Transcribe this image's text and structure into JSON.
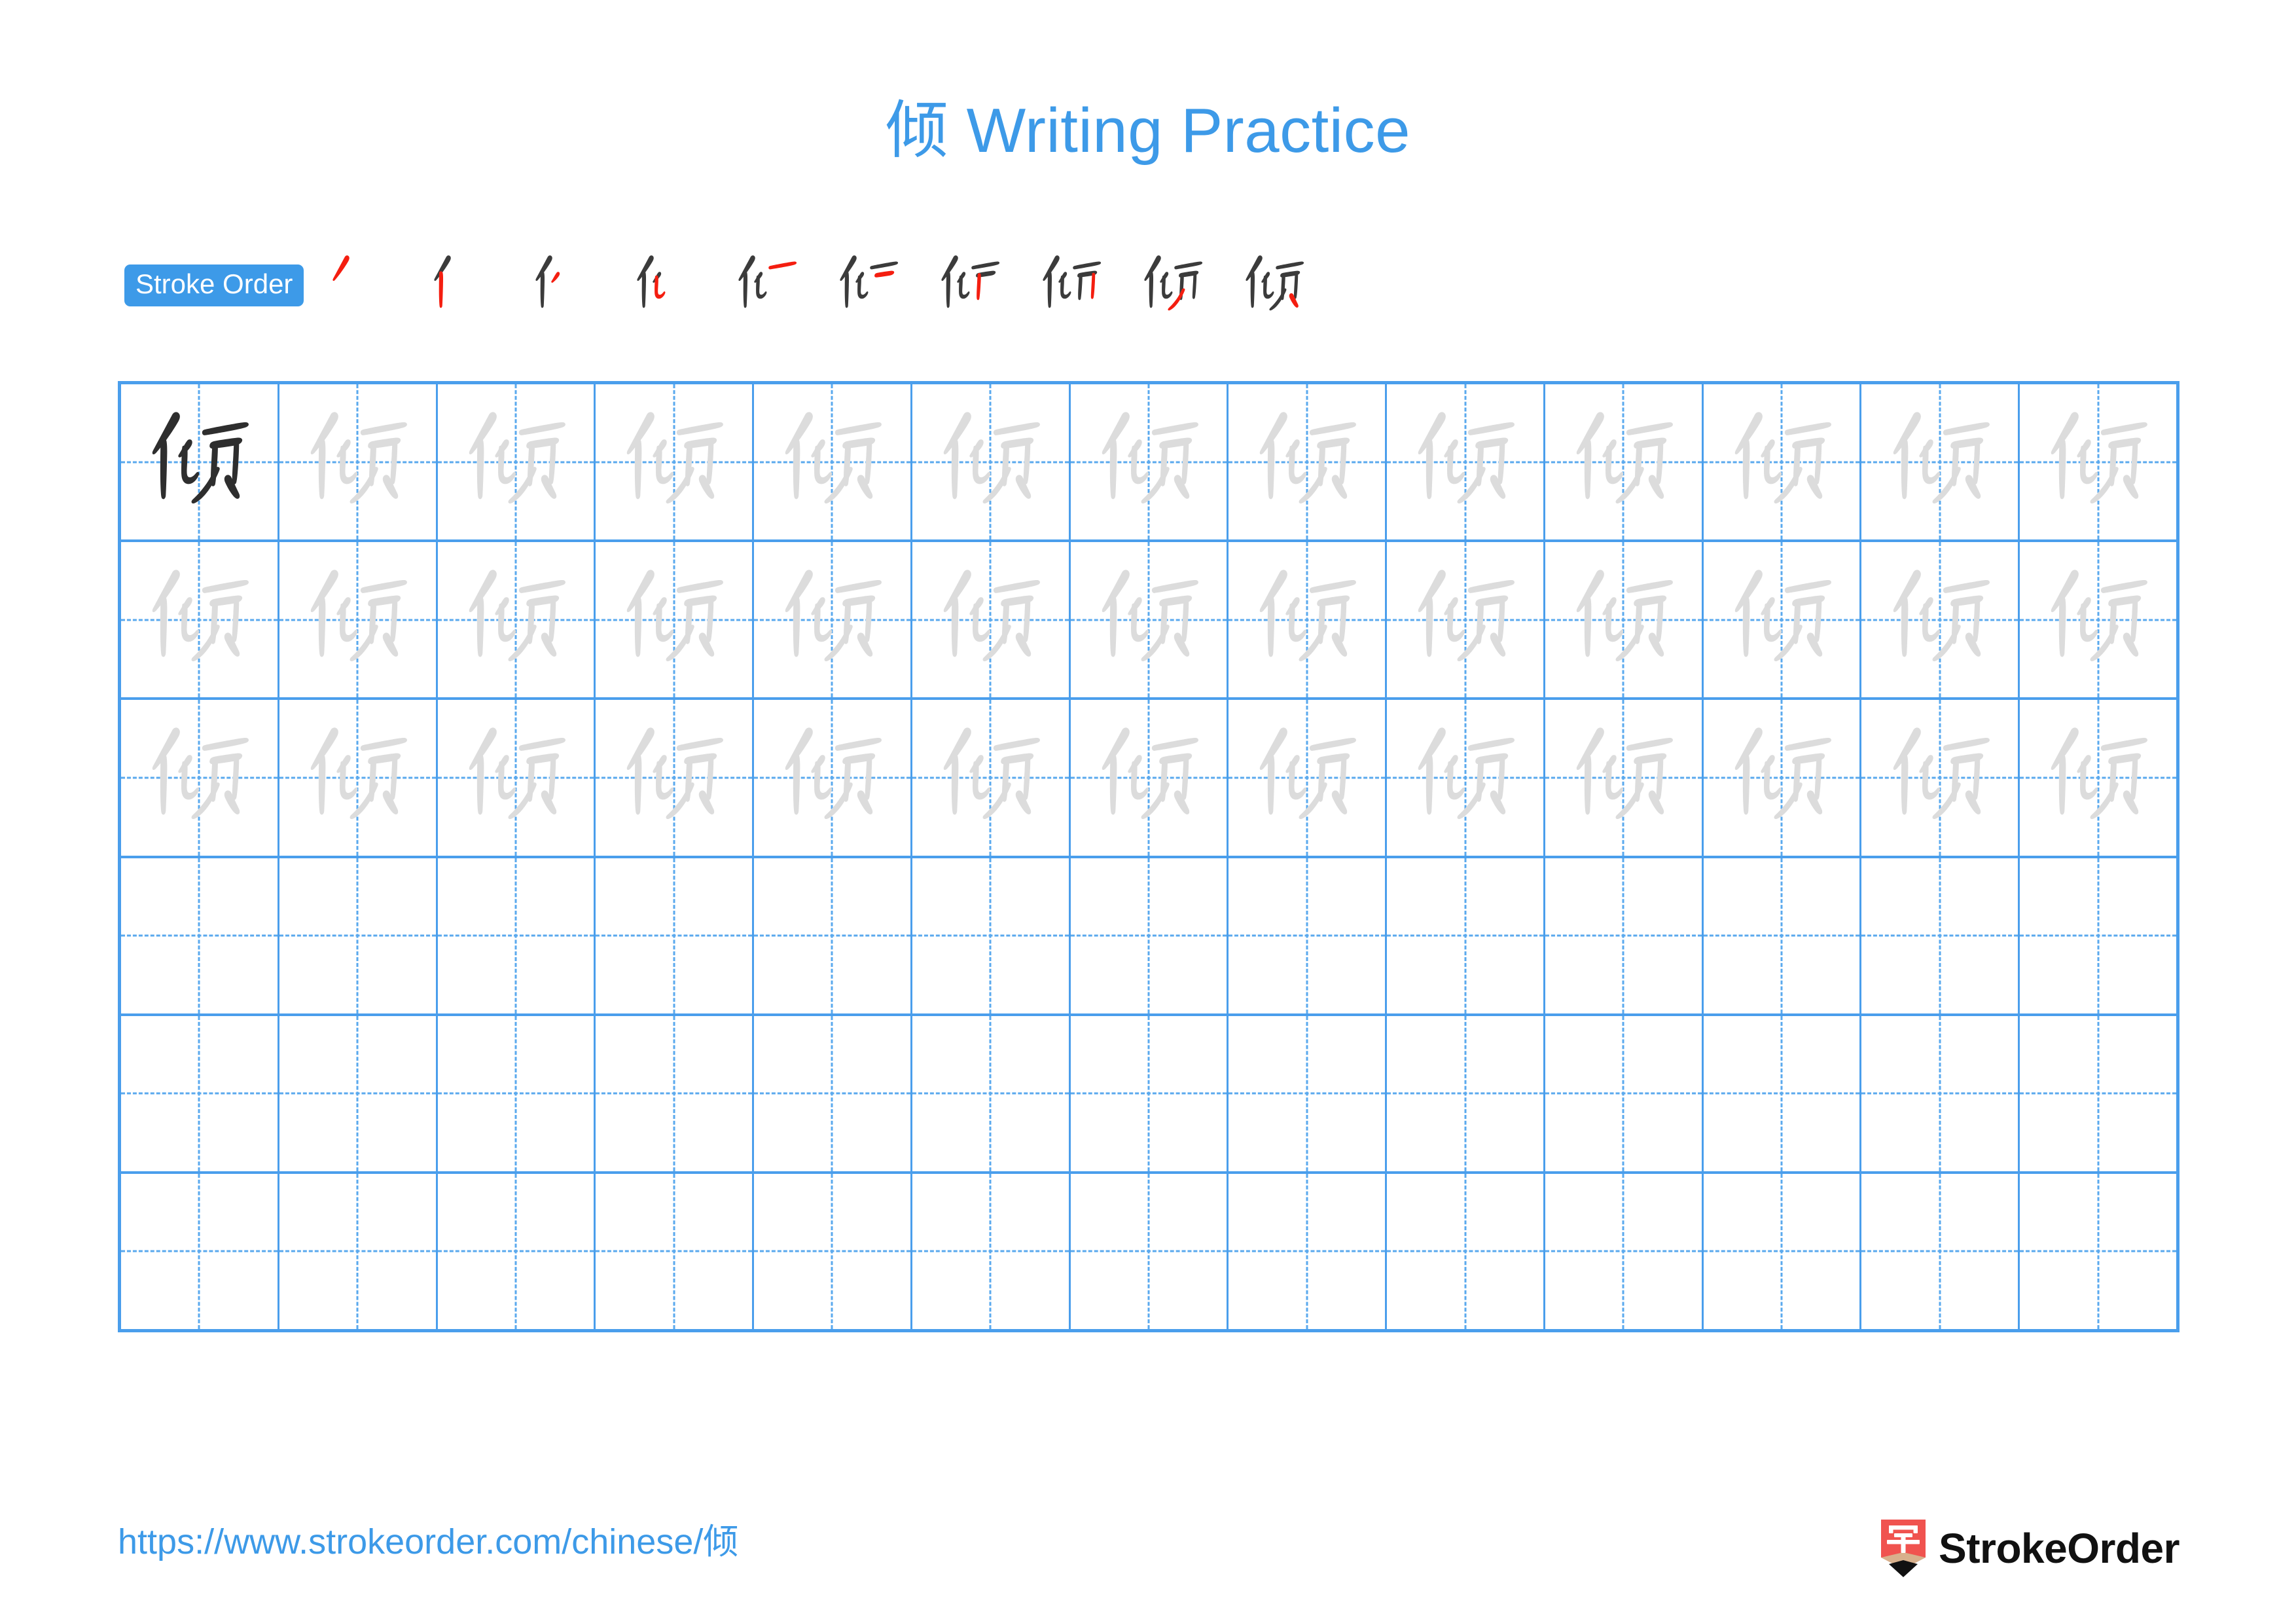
{
  "character": "倾",
  "title": "倾 Writing Practice",
  "colors": {
    "accent_blue": "#3d9ae8",
    "grid_blue": "#4a9eec",
    "guide_blue": "#5aa9ee",
    "stroke_new_red": "#f41e10",
    "stroke_done_gray": "#3b3b3b",
    "glyph_dark": "#2e2e2e",
    "glyph_trace_gray": "#dcdcdc",
    "logo_red": "#f0534f",
    "logo_wood": "#d8b08c"
  },
  "stroke_order": {
    "badge_label": "Stroke Order",
    "total_strokes": 10,
    "steps": [
      {
        "index": 1,
        "name": "stroke-step-1",
        "strokes_drawn": 1
      },
      {
        "index": 2,
        "name": "stroke-step-2",
        "strokes_drawn": 2
      },
      {
        "index": 3,
        "name": "stroke-step-3",
        "strokes_drawn": 3
      },
      {
        "index": 4,
        "name": "stroke-step-4",
        "strokes_drawn": 4
      },
      {
        "index": 5,
        "name": "stroke-step-5",
        "strokes_drawn": 5
      },
      {
        "index": 6,
        "name": "stroke-step-6",
        "strokes_drawn": 6
      },
      {
        "index": 7,
        "name": "stroke-step-7",
        "strokes_drawn": 7
      },
      {
        "index": 8,
        "name": "stroke-step-8",
        "strokes_drawn": 8
      },
      {
        "index": 9,
        "name": "stroke-step-9",
        "strokes_drawn": 9
      },
      {
        "index": 10,
        "name": "stroke-step-10",
        "strokes_drawn": 10
      }
    ]
  },
  "practice_grid": {
    "columns": 13,
    "rows": 6,
    "rows_data": [
      {
        "row": 1,
        "cells": [
          "dark",
          "trace",
          "trace",
          "trace",
          "trace",
          "trace",
          "trace",
          "trace",
          "trace",
          "trace",
          "trace",
          "trace",
          "trace"
        ]
      },
      {
        "row": 2,
        "cells": [
          "trace",
          "trace",
          "trace",
          "trace",
          "trace",
          "trace",
          "trace",
          "trace",
          "trace",
          "trace",
          "trace",
          "trace",
          "trace"
        ]
      },
      {
        "row": 3,
        "cells": [
          "trace",
          "trace",
          "trace",
          "trace",
          "trace",
          "trace",
          "trace",
          "trace",
          "trace",
          "trace",
          "trace",
          "trace",
          "trace"
        ]
      },
      {
        "row": 4,
        "cells": [
          "empty",
          "empty",
          "empty",
          "empty",
          "empty",
          "empty",
          "empty",
          "empty",
          "empty",
          "empty",
          "empty",
          "empty",
          "empty"
        ]
      },
      {
        "row": 5,
        "cells": [
          "empty",
          "empty",
          "empty",
          "empty",
          "empty",
          "empty",
          "empty",
          "empty",
          "empty",
          "empty",
          "empty",
          "empty",
          "empty"
        ]
      },
      {
        "row": 6,
        "cells": [
          "empty",
          "empty",
          "empty",
          "empty",
          "empty",
          "empty",
          "empty",
          "empty",
          "empty",
          "empty",
          "empty",
          "empty",
          "empty"
        ]
      }
    ]
  },
  "footer": {
    "url": "https://www.strokeorder.com/chinese/倾",
    "logo_text": "StrokeOrder",
    "logo_glyph": "字"
  }
}
